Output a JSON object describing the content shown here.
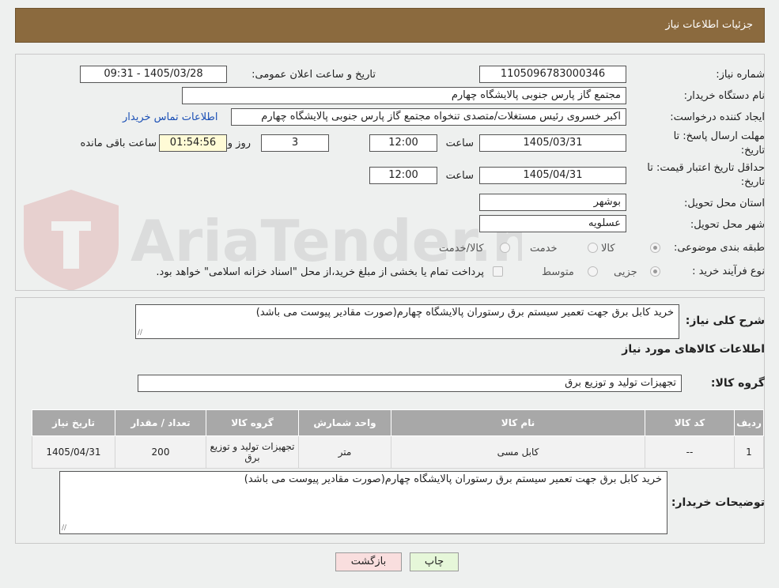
{
  "header": {
    "title": "جزئیات اطلاعات نیاز"
  },
  "watermark": {
    "text": "AriaTender.neT"
  },
  "form": {
    "need_number_label": "شماره نیاز:",
    "need_number": "1105096783000346",
    "announce_label": "تاریخ و ساعت اعلان عمومی:",
    "announce_value": "1405/03/28 - 09:31",
    "buyer_org_label": "نام دستگاه خریدار:",
    "buyer_org": "مجتمع گاز پارس جنوبی  پالایشگاه چهارم",
    "creator_label": "ایجاد کننده درخواست:",
    "creator": "اکبر خسروی  رئیس مستغلات/متصدی تنخواه مجتمع گاز پارس جنوبی  پالایشگاه چهارم",
    "contact_link": "اطلاعات تماس خریدار",
    "deadline_label": "مهلت ارسال پاسخ: تا تاریخ:",
    "deadline_date": "1405/03/31",
    "time_label": "ساعت",
    "deadline_time": "12:00",
    "days_value": "3",
    "days_label": "روز و",
    "remaining_time": "01:54:56",
    "remaining_label": "ساعت باقی مانده",
    "validity_label": "حداقل تاریخ اعتبار قیمت: تا تاریخ:",
    "validity_date": "1405/04/31",
    "validity_time": "12:00",
    "province_label": "استان محل تحویل:",
    "province": "بوشهر",
    "city_label": "شهر محل تحویل:",
    "city": "عسلویه",
    "category_label": "طبقه بندی موضوعی:",
    "category_options": [
      "کالا",
      "خدمت",
      "کالا/خدمت"
    ],
    "process_label": "نوع فرآیند خرید :",
    "process_options": [
      "جزیی",
      "متوسط"
    ],
    "payment_note": "پرداخت تمام یا بخشی از مبلغ خرید،از محل \"اسناد خزانه اسلامی\" خواهد بود."
  },
  "summary": {
    "desc_label": "شرح کلی نیاز:",
    "desc": "خرید کابل برق جهت تعمیر سیستم برق رستوران پالایشگاه چهارم(صورت مقادیر پیوست می باشد)",
    "goods_info_title": "اطلاعات کالاهای مورد نیاز",
    "group_label": "گروه کالا:",
    "group": "تجهیزات تولید و توزیع برق"
  },
  "table": {
    "headers": [
      "ردیف",
      "کد کالا",
      "نام کالا",
      "واحد شمارش",
      "گروه کالا",
      "تعداد / مقدار",
      "تاریخ نیاز"
    ],
    "rows": [
      [
        "1",
        "--",
        "کابل مسی",
        "متر",
        "تجهیزات تولید و توزیع برق",
        "200",
        "1405/04/31"
      ]
    ]
  },
  "buyer_notes": {
    "label": "توضیحات خریدار:",
    "text": "خرید کابل برق جهت تعمیر سیستم برق رستوران پالایشگاه چهارم(صورت مقادیر پیوست می باشد)"
  },
  "buttons": {
    "print": "چاپ",
    "back": "بازگشت"
  },
  "colors": {
    "header_bg": "#8b6a3e",
    "link": "#1a4fb5",
    "table_header": "#a8a8a8",
    "print_btn": "#e6f7d9",
    "back_btn": "#f9dede"
  }
}
